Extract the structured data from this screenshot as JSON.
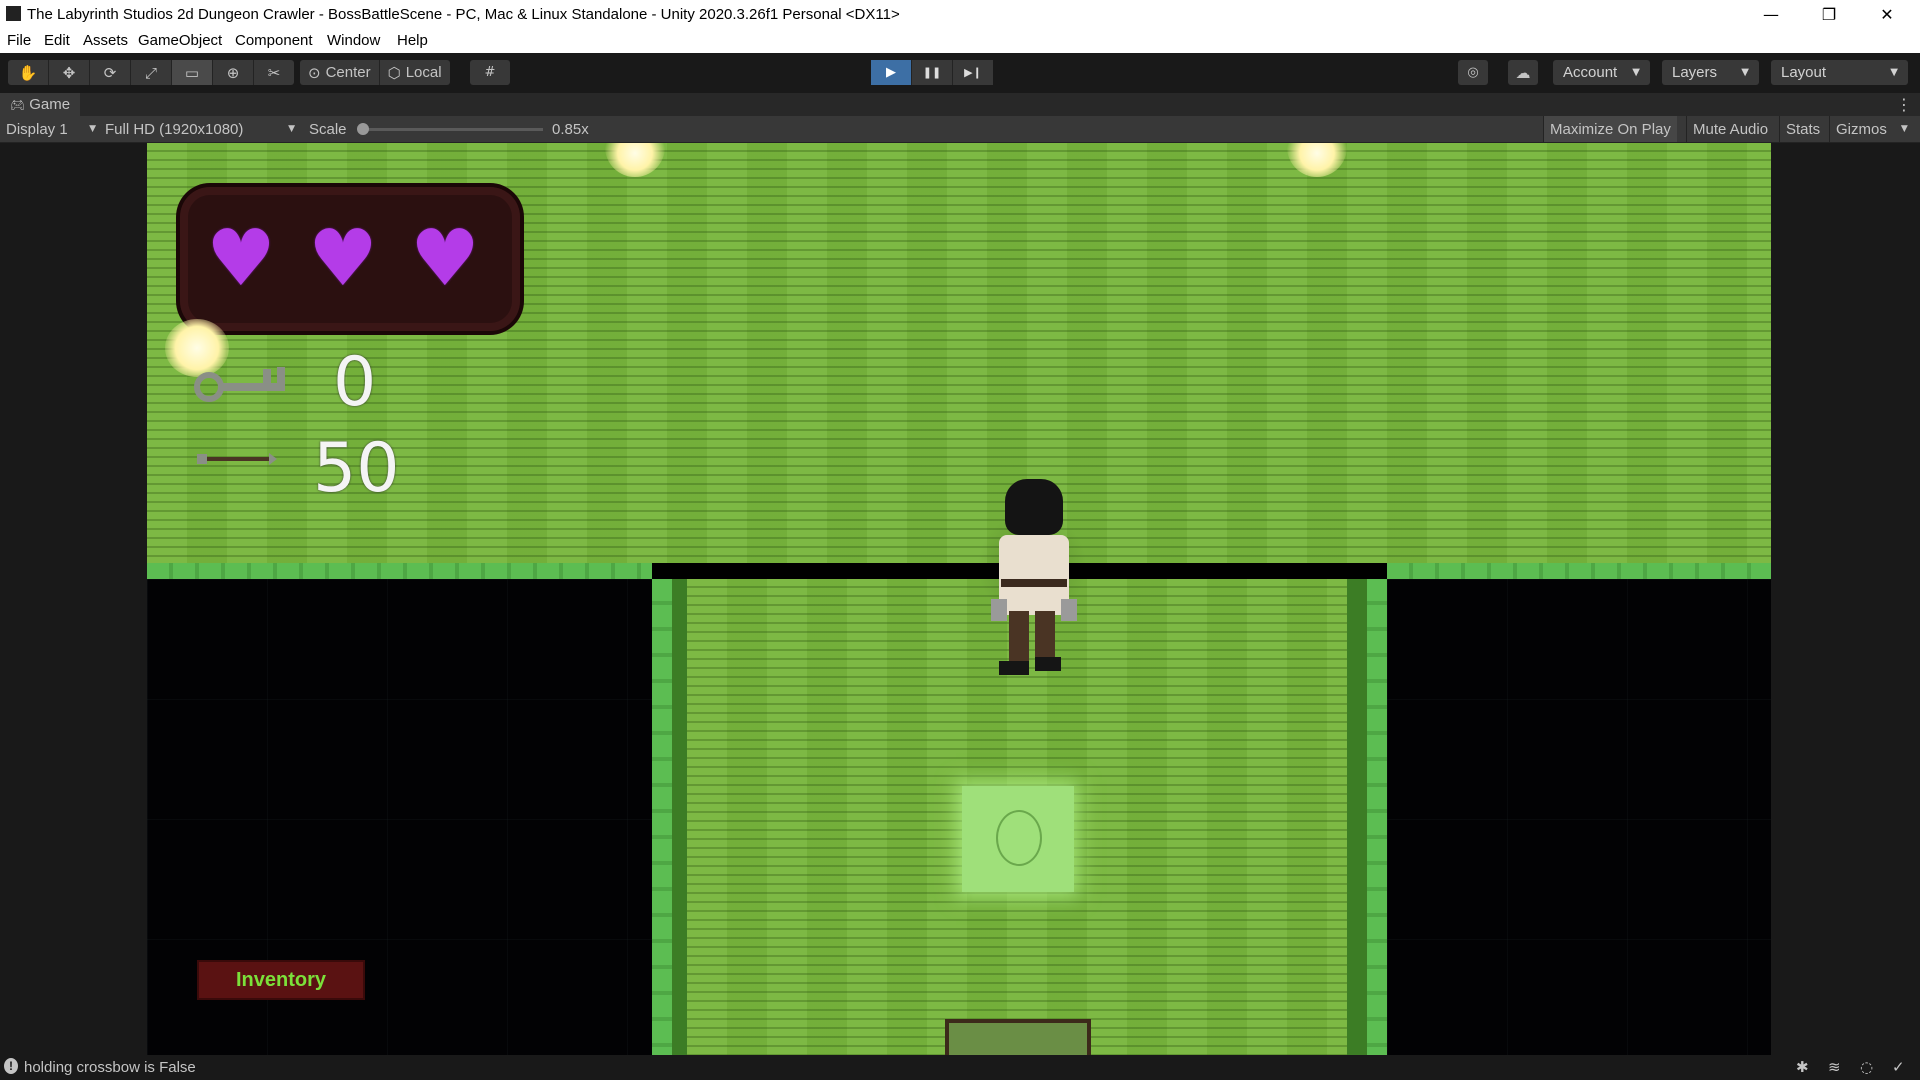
{
  "window": {
    "title": "The Labyrinth Studios 2d Dungeon Crawler - BossBattleScene - PC, Mac & Linux Standalone - Unity 2020.3.26f1 Personal <DX11>",
    "controls": {
      "minimize": "—",
      "maximize": "❐",
      "close": "✕"
    }
  },
  "menu": {
    "items": [
      "File",
      "Edit",
      "Assets",
      "GameObject",
      "Component",
      "Window",
      "Help"
    ]
  },
  "toolbar": {
    "tools": [
      {
        "name": "hand-tool-icon",
        "glyph": "✋"
      },
      {
        "name": "move-tool-icon",
        "glyph": "✥"
      },
      {
        "name": "rotate-tool-icon",
        "glyph": "⟳"
      },
      {
        "name": "scale-tool-icon",
        "glyph": "⤢"
      },
      {
        "name": "rect-tool-icon",
        "glyph": "▭"
      },
      {
        "name": "transform-tool-icon",
        "glyph": "⊕"
      },
      {
        "name": "custom-tool-icon",
        "glyph": "✂"
      }
    ],
    "pivot": "Center",
    "space": "Local",
    "snap_icon": "grid-snap-icon",
    "play": "▶",
    "pause": "❚❚",
    "step": "▶❙",
    "account": "Account",
    "layers": "Layers",
    "layout": "Layout",
    "accent": "#3d6fa5"
  },
  "game_tab": {
    "label": "Game",
    "menu_glyph": "⋮"
  },
  "game_toolbar": {
    "display": "Display 1",
    "resolution": "Full HD (1920x1080)",
    "scale_label": "Scale",
    "scale_value": "0.85x",
    "maximize_on_play": "Maximize On Play",
    "mute_audio": "Mute Audio",
    "stats": "Stats",
    "gizmos": "Gizmos"
  },
  "game": {
    "hearts": 3,
    "heart_glyph": "♥",
    "heart_color": "#b43ce8",
    "keys_count": "0",
    "arrows_count": "50",
    "inventory_label": "Inventory",
    "inventory_text_color": "#7be03a"
  },
  "status": {
    "message": "holding crossbow is False"
  }
}
